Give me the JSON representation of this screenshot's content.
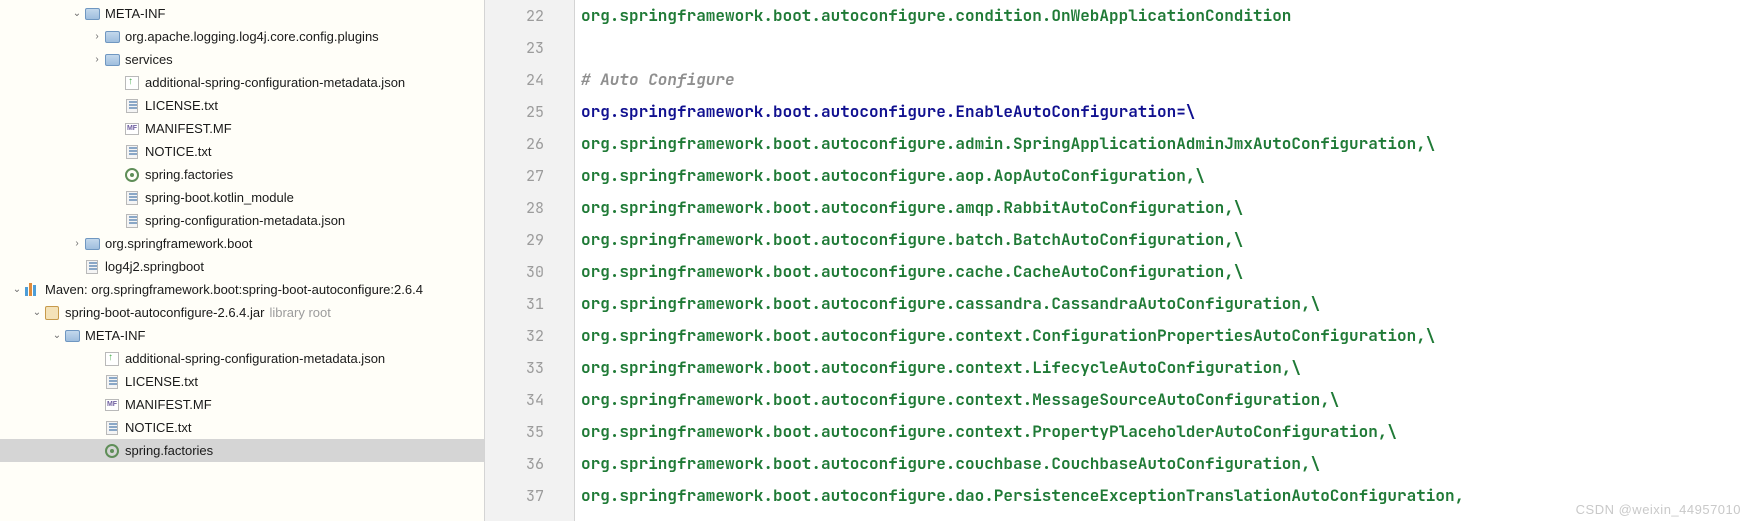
{
  "tree": [
    {
      "indent": 3,
      "arrow": "down",
      "icon": "folder",
      "label": "META-INF"
    },
    {
      "indent": 4,
      "arrow": "right",
      "icon": "folder",
      "label": "org.apache.logging.log4j.core.config.plugins"
    },
    {
      "indent": 4,
      "arrow": "right",
      "icon": "folder",
      "label": "services"
    },
    {
      "indent": 5,
      "arrow": "",
      "icon": "json",
      "label": "additional-spring-configuration-metadata.json"
    },
    {
      "indent": 5,
      "arrow": "",
      "icon": "file",
      "label": "LICENSE.txt"
    },
    {
      "indent": 5,
      "arrow": "",
      "icon": "mf",
      "label": "MANIFEST.MF"
    },
    {
      "indent": 5,
      "arrow": "",
      "icon": "file",
      "label": "NOTICE.txt"
    },
    {
      "indent": 5,
      "arrow": "",
      "icon": "gear",
      "label": "spring.factories"
    },
    {
      "indent": 5,
      "arrow": "",
      "icon": "file",
      "label": "spring-boot.kotlin_module"
    },
    {
      "indent": 5,
      "arrow": "",
      "icon": "file",
      "label": "spring-configuration-metadata.json"
    },
    {
      "indent": 3,
      "arrow": "right",
      "icon": "folder",
      "label": "org.springframework.boot"
    },
    {
      "indent": 3,
      "arrow": "",
      "icon": "file",
      "label": "log4j2.springboot"
    },
    {
      "indent": 0,
      "arrow": "down",
      "icon": "lib",
      "label": "Maven: org.springframework.boot:spring-boot-autoconfigure:2.6.4"
    },
    {
      "indent": 1,
      "arrow": "down",
      "icon": "jar",
      "label": "spring-boot-autoconfigure-2.6.4.jar",
      "hint": "library root"
    },
    {
      "indent": 2,
      "arrow": "down",
      "icon": "folder",
      "label": "META-INF"
    },
    {
      "indent": 4,
      "arrow": "",
      "icon": "json",
      "label": "additional-spring-configuration-metadata.json"
    },
    {
      "indent": 4,
      "arrow": "",
      "icon": "file",
      "label": "LICENSE.txt"
    },
    {
      "indent": 4,
      "arrow": "",
      "icon": "mf",
      "label": "MANIFEST.MF"
    },
    {
      "indent": 4,
      "arrow": "",
      "icon": "file",
      "label": "NOTICE.txt"
    },
    {
      "indent": 4,
      "arrow": "",
      "icon": "gear",
      "label": "spring.factories",
      "selected": true
    }
  ],
  "editor": {
    "first_line_no": 22,
    "lines": [
      {
        "type": "green",
        "text": "org.springframework.boot.autoconfigure.condition.OnWebApplicationCondition"
      },
      {
        "type": "blank",
        "text": ""
      },
      {
        "type": "comment",
        "text": "# Auto Configure"
      },
      {
        "type": "navy",
        "text": "org.springframework.boot.autoconfigure.EnableAutoConfiguration=\\"
      },
      {
        "type": "green",
        "text": "org.springframework.boot.autoconfigure.admin.SpringApplicationAdminJmxAutoConfiguration,\\"
      },
      {
        "type": "green",
        "text": "org.springframework.boot.autoconfigure.aop.AopAutoConfiguration,\\"
      },
      {
        "type": "green",
        "text": "org.springframework.boot.autoconfigure.amqp.RabbitAutoConfiguration,\\"
      },
      {
        "type": "green",
        "text": "org.springframework.boot.autoconfigure.batch.BatchAutoConfiguration,\\"
      },
      {
        "type": "green",
        "text": "org.springframework.boot.autoconfigure.cache.CacheAutoConfiguration,\\"
      },
      {
        "type": "green",
        "text": "org.springframework.boot.autoconfigure.cassandra.CassandraAutoConfiguration,\\"
      },
      {
        "type": "green",
        "text": "org.springframework.boot.autoconfigure.context.ConfigurationPropertiesAutoConfiguration,\\"
      },
      {
        "type": "green",
        "text": "org.springframework.boot.autoconfigure.context.LifecycleAutoConfiguration,\\"
      },
      {
        "type": "green",
        "text": "org.springframework.boot.autoconfigure.context.MessageSourceAutoConfiguration,\\"
      },
      {
        "type": "green",
        "text": "org.springframework.boot.autoconfigure.context.PropertyPlaceholderAutoConfiguration,\\"
      },
      {
        "type": "green",
        "text": "org.springframework.boot.autoconfigure.couchbase.CouchbaseAutoConfiguration,\\"
      },
      {
        "type": "green",
        "text": "org.springframework.boot.autoconfigure.dao.PersistenceExceptionTranslationAutoConfiguration,"
      }
    ]
  },
  "watermark": "CSDN @weixin_44957010"
}
